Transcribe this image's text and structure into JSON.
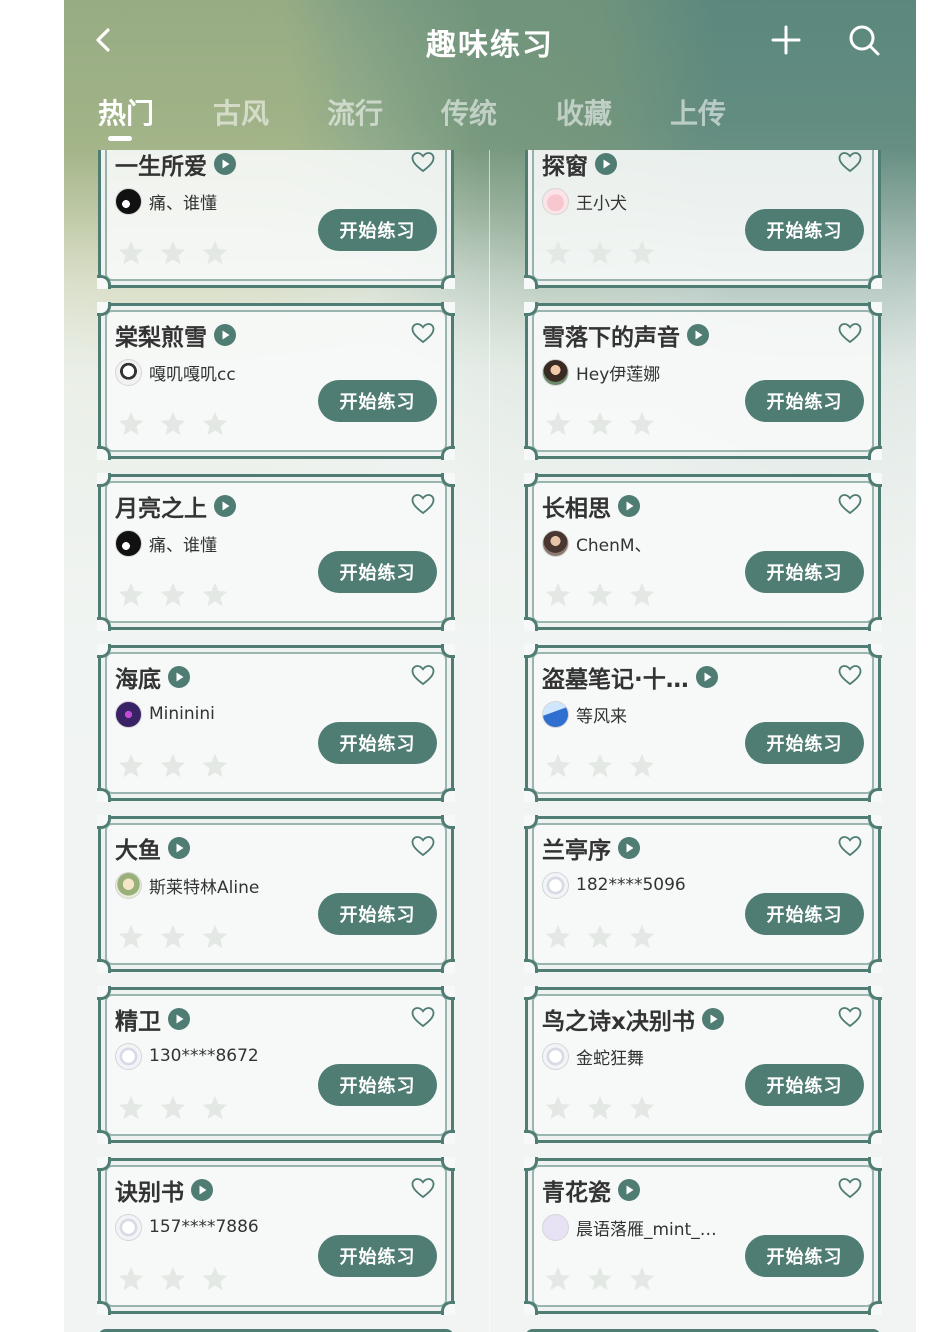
{
  "header": {
    "title": "趣味练习",
    "back_icon": "chevron-left-icon",
    "add_icon": "plus-icon",
    "search_icon": "search-icon"
  },
  "tabs": [
    {
      "label": "热门",
      "active": true
    },
    {
      "label": "古风",
      "active": false
    },
    {
      "label": "流行",
      "active": false
    },
    {
      "label": "传统",
      "active": false
    },
    {
      "label": "收藏",
      "active": false
    },
    {
      "label": "上传",
      "active": false
    }
  ],
  "colors": {
    "accent": "#4f7c73",
    "star_empty": "#e3e8e5",
    "text": "#333333"
  },
  "start_label": "开始练习",
  "songs": [
    {
      "title": "一生所爱",
      "author": "痛、谁懂",
      "avatar": "avatar-black-white",
      "rating": 0
    },
    {
      "title": "探窗",
      "author": "王小犬",
      "avatar": "avatar-pink",
      "rating": 0
    },
    {
      "title": "棠梨煎雪",
      "author": "嘎叽嘎叽cc",
      "avatar": "avatar-sketch",
      "rating": 0
    },
    {
      "title": "雪落下的声音",
      "author": "Hey伊莲娜",
      "avatar": "avatar-portrait",
      "rating": 0
    },
    {
      "title": "月亮之上",
      "author": "痛、谁懂",
      "avatar": "avatar-black-white",
      "rating": 0
    },
    {
      "title": "长相思",
      "author": "ChenM、",
      "avatar": "avatar-portrait-dark",
      "rating": 0
    },
    {
      "title": "海底",
      "author": "Mininini",
      "avatar": "avatar-purple",
      "rating": 0
    },
    {
      "title": "盗墓笔记·十…",
      "author": "等风来",
      "avatar": "avatar-blue",
      "rating": 0
    },
    {
      "title": "大鱼",
      "author": "斯莱特林Aline",
      "avatar": "avatar-anime",
      "rating": 0
    },
    {
      "title": "兰亭序",
      "author": "182****5096",
      "avatar": "avatar-default",
      "rating": 0
    },
    {
      "title": "精卫",
      "author": "130****8672",
      "avatar": "avatar-default",
      "rating": 0
    },
    {
      "title": "鸟之诗x决别书",
      "author": "金蛇狂舞",
      "avatar": "avatar-default",
      "rating": 0
    },
    {
      "title": "诀别书",
      "author": "157****7886",
      "avatar": "avatar-default",
      "rating": 0
    },
    {
      "title": "青花瓷",
      "author": "晨语落雁_mint_…",
      "avatar": "avatar-text",
      "rating": 0
    }
  ]
}
